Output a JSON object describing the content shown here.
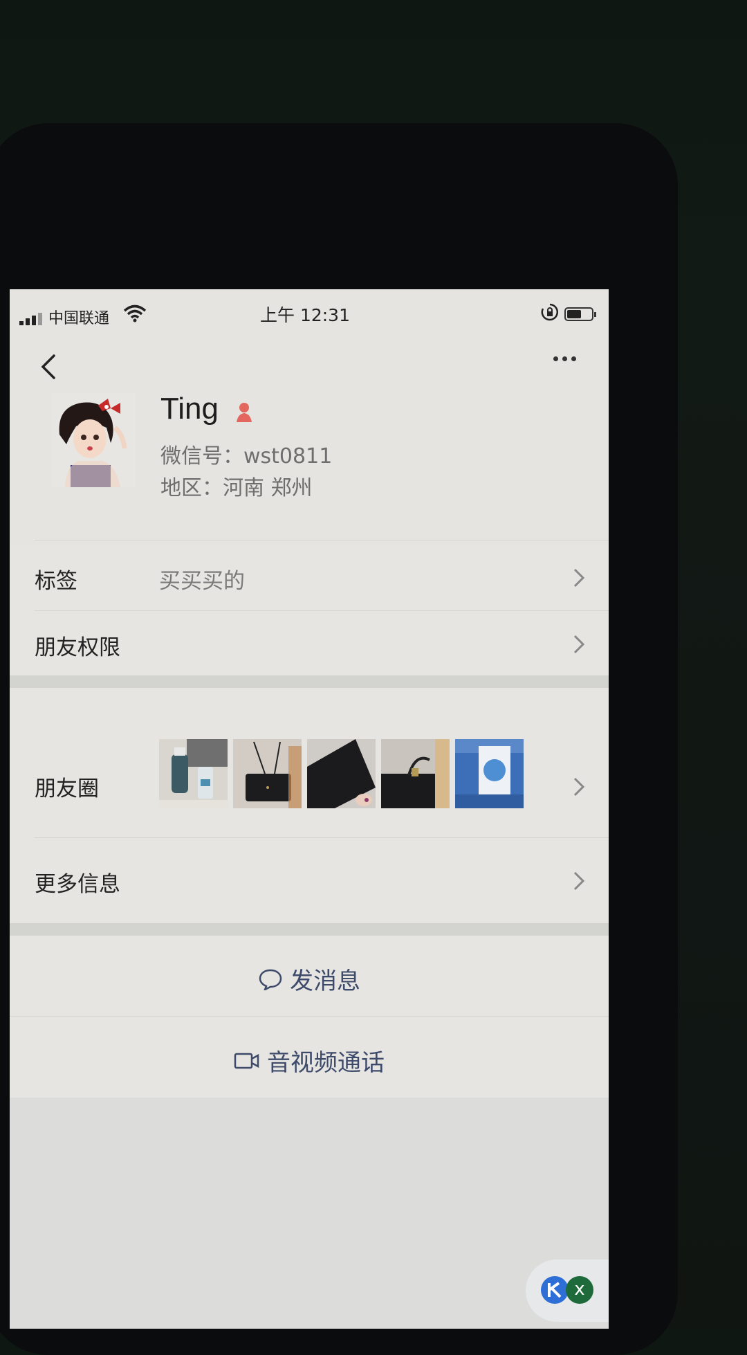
{
  "status_bar": {
    "carrier": "中国联通",
    "time": "上午 12:31"
  },
  "profile": {
    "name": "Ting",
    "wechat_id": "微信号：wst0811",
    "region": "地区：河南 郑州"
  },
  "rows": {
    "tags_label": "标签",
    "tags_value": "买买买的",
    "permissions_label": "朋友权限",
    "moments_label": "朋友圈",
    "more_info_label": "更多信息"
  },
  "actions": {
    "send_message": "发消息",
    "video_call": "音视频通话"
  },
  "floating_widget": {
    "close": "x"
  }
}
